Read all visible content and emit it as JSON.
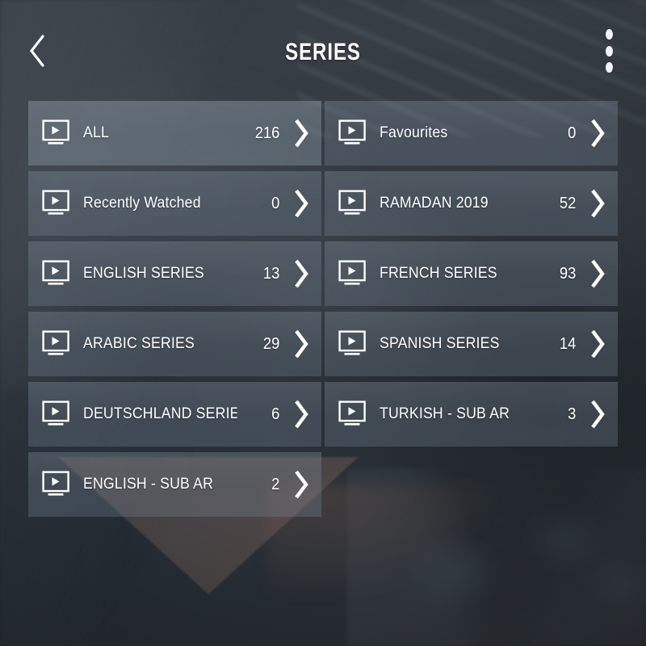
{
  "header": {
    "title": "SERIES",
    "back_icon": "chevron-left-icon",
    "menu_icon": "kebab-menu-icon"
  },
  "colors": {
    "card_bg": "#7b8b9b",
    "card_selected_bg": "#96a6b4",
    "text": "#ffffff",
    "page_bg": "#2e343a",
    "accent_triangle": "#7e645c"
  },
  "list": {
    "item_icon": "tv-play-icon",
    "chevron_icon": "chevron-right-icon",
    "items": [
      {
        "label": "ALL",
        "count": "216",
        "selected": true
      },
      {
        "label": "Favourites",
        "count": "0",
        "selected": false
      },
      {
        "label": "Recently Watched",
        "count": "0",
        "selected": false
      },
      {
        "label": "RAMADAN 2019",
        "count": "52",
        "selected": false
      },
      {
        "label": "ENGLISH SERIES",
        "count": "13",
        "selected": false
      },
      {
        "label": "FRENCH SERIES",
        "count": "93",
        "selected": false
      },
      {
        "label": "ARABIC SERIES",
        "count": "29",
        "selected": false
      },
      {
        "label": "SPANISH SERIES",
        "count": "14",
        "selected": false
      },
      {
        "label": "DEUTSCHLAND SERIES",
        "count": "6",
        "selected": false
      },
      {
        "label": "TURKISH - SUB AR",
        "count": "3",
        "selected": false
      },
      {
        "label": "ENGLISH - SUB AR",
        "count": "2",
        "selected": false
      }
    ]
  }
}
